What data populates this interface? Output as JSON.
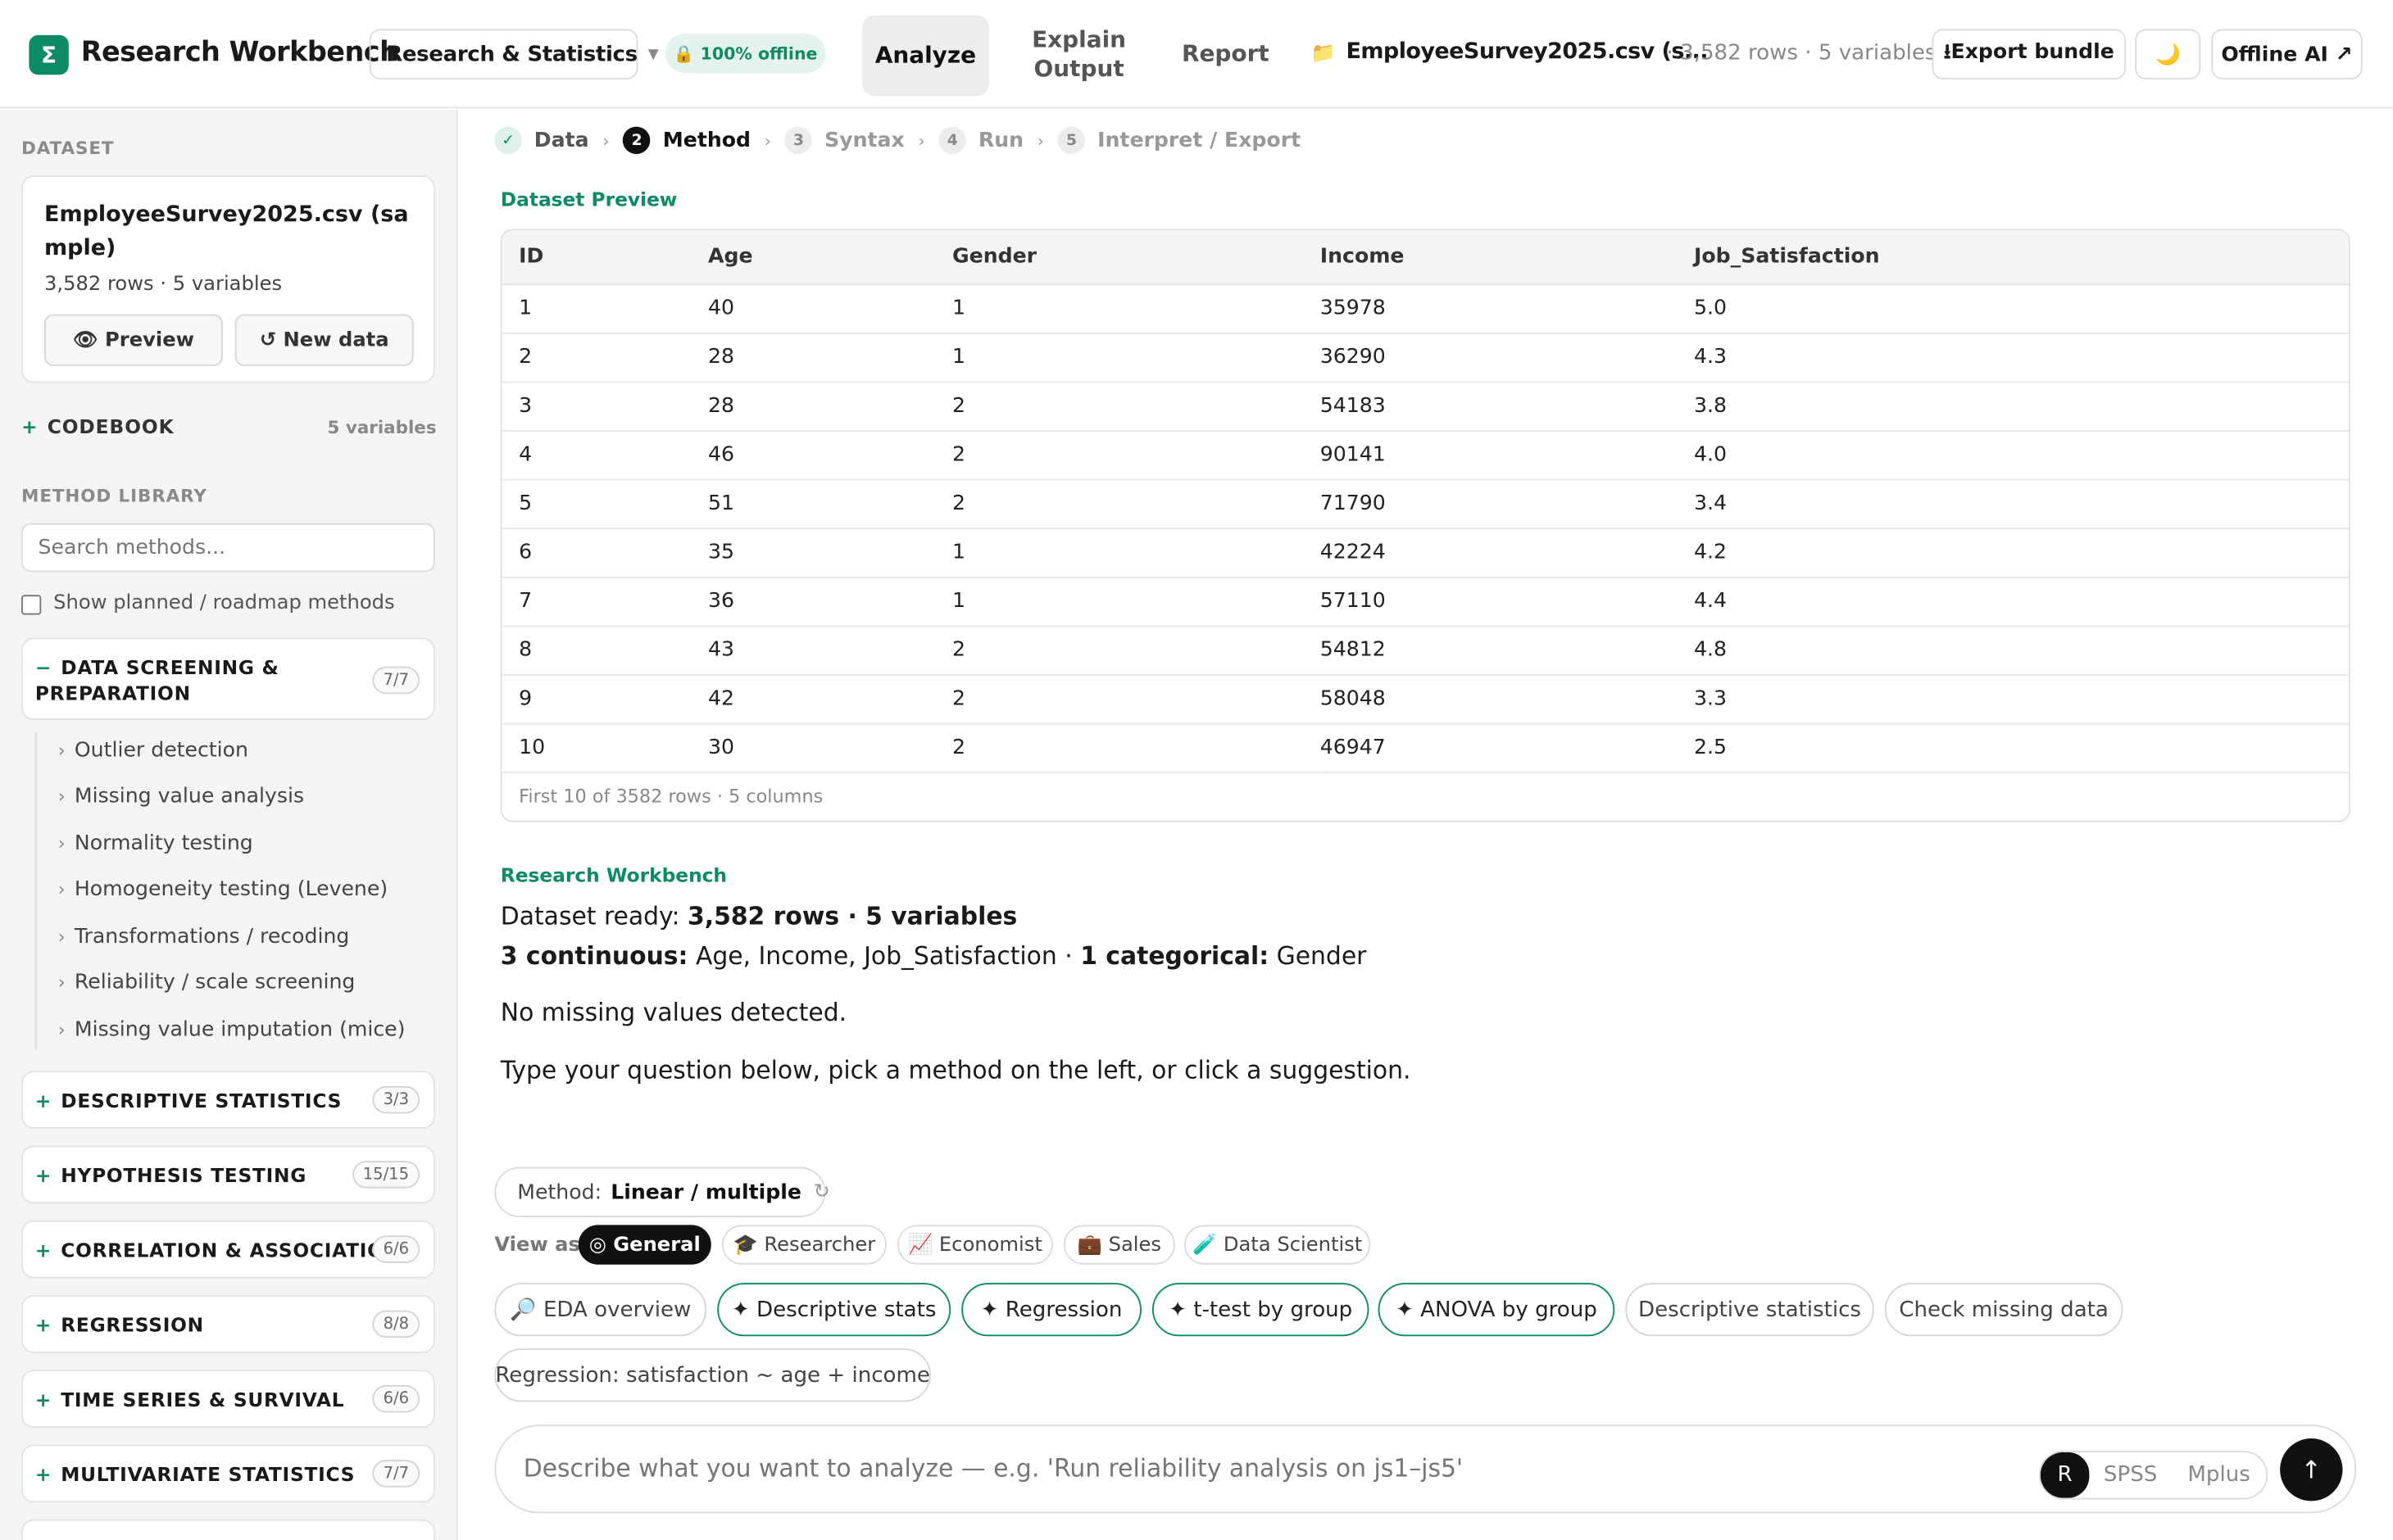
{
  "app": {
    "logo_glyph": "Σ",
    "title": "Research Workbench"
  },
  "workspace": {
    "label": "Research & Statistics"
  },
  "offline_badge": "🔒 100% offline",
  "nav": {
    "analyze": "Analyze",
    "explain_1": "Explain",
    "explain_2": "Output",
    "report": "Report"
  },
  "file": {
    "icon": "folder-icon",
    "name": "EmployeeSurvey2025.csv (s...",
    "meta": "· 3,582 rows · 5 variables"
  },
  "toolbar": {
    "export": "⭳Export bundle",
    "theme": "🌙",
    "offline_ai": "Offline AI ↗"
  },
  "sidebar": {
    "dataset_label": "DATASET",
    "dataset_name": "EmployeeSurvey2025.csv (sample)",
    "dataset_meta": "3,582 rows · 5 variables",
    "preview_btn": "👁 Preview",
    "newdata_btn": "↺ New data",
    "codebook": "CODEBOOK",
    "codebook_count": "5 variables",
    "method_library_label": "METHOD LIBRARY",
    "search_placeholder": "Search methods...",
    "show_planned": "Show planned / roadmap methods",
    "categories": [
      {
        "title": "DATA SCREENING & PREPARATION",
        "count": "7/7",
        "toggle": "−"
      },
      {
        "title": "DESCRIPTIVE STATISTICS",
        "count": "3/3",
        "toggle": "+"
      },
      {
        "title": "HYPOTHESIS TESTING",
        "count": "15/15",
        "toggle": "+"
      },
      {
        "title": "CORRELATION & ASSOCIATION",
        "count": "6/6",
        "toggle": "+"
      },
      {
        "title": "REGRESSION",
        "count": "8/8",
        "toggle": "+"
      },
      {
        "title": "TIME SERIES & SURVIVAL",
        "count": "6/6",
        "toggle": "+"
      },
      {
        "title": "MULTIVARIATE STATISTICS",
        "count": "7/7",
        "toggle": "+"
      }
    ],
    "screening_items": [
      "Outlier detection",
      "Missing value analysis",
      "Normality testing",
      "Homogeneity testing (Levene)",
      "Transformations / recoding",
      "Reliability / scale screening",
      "Missing value imputation (mice)"
    ]
  },
  "steps": [
    {
      "num": "✓",
      "label": "Data"
    },
    {
      "num": "2",
      "label": "Method"
    },
    {
      "num": "3",
      "label": "Syntax"
    },
    {
      "num": "4",
      "label": "Run"
    },
    {
      "num": "5",
      "label": "Interpret / Export"
    }
  ],
  "preview": {
    "label": "Dataset Preview",
    "columns": [
      "ID",
      "Age",
      "Gender",
      "Income",
      "Job_Satisfaction"
    ],
    "rows": [
      [
        "1",
        "40",
        "1",
        "35978",
        "5.0"
      ],
      [
        "2",
        "28",
        "1",
        "36290",
        "4.3"
      ],
      [
        "3",
        "28",
        "2",
        "54183",
        "3.8"
      ],
      [
        "4",
        "46",
        "2",
        "90141",
        "4.0"
      ],
      [
        "5",
        "51",
        "2",
        "71790",
        "3.4"
      ],
      [
        "6",
        "35",
        "1",
        "42224",
        "4.2"
      ],
      [
        "7",
        "36",
        "1",
        "57110",
        "4.4"
      ],
      [
        "8",
        "43",
        "2",
        "54812",
        "4.8"
      ],
      [
        "9",
        "42",
        "2",
        "58048",
        "3.3"
      ],
      [
        "10",
        "30",
        "2",
        "46947",
        "2.5"
      ]
    ],
    "footer": "First 10 of 3582 rows · 5 columns"
  },
  "message": {
    "sender": "Research Workbench",
    "ready_prefix": "Dataset ready: ",
    "ready_bold": "3,582 rows · 5 variables",
    "cont_bold": "3 continuous:",
    "cont_vars": " Age, Income, Job_Satisfaction · ",
    "cat_bold": "1 categorical:",
    "cat_vars": " Gender",
    "missing": "No missing values detected.",
    "hint": "Type your question below, pick a method on the left, or click a suggestion."
  },
  "method_pill": {
    "label": "Method:",
    "value": "Linear / multiple",
    "icon": "↻"
  },
  "view_as": {
    "label": "View as",
    "options": [
      "◎ General",
      "🎓 Researcher",
      "📈 Economist",
      "💼 Sales",
      "🧪 Data Scientist"
    ]
  },
  "suggestions": [
    "🔎 EDA overview",
    "✦ Descriptive stats",
    "✦ Regression",
    "✦ t-test by group",
    "✦ ANOVA by group",
    "Descriptive statistics",
    "Check missing data",
    "Regression: satisfaction ~ age + income"
  ],
  "composer": {
    "placeholder": "Describe what you want to analyze — e.g. 'Run reliability analysis on js1–js5'",
    "langs": [
      "R",
      "SPSS",
      "Mplus"
    ],
    "send": "↑"
  },
  "colors": {
    "accent": "#0d8a66",
    "dark": "#111111"
  }
}
